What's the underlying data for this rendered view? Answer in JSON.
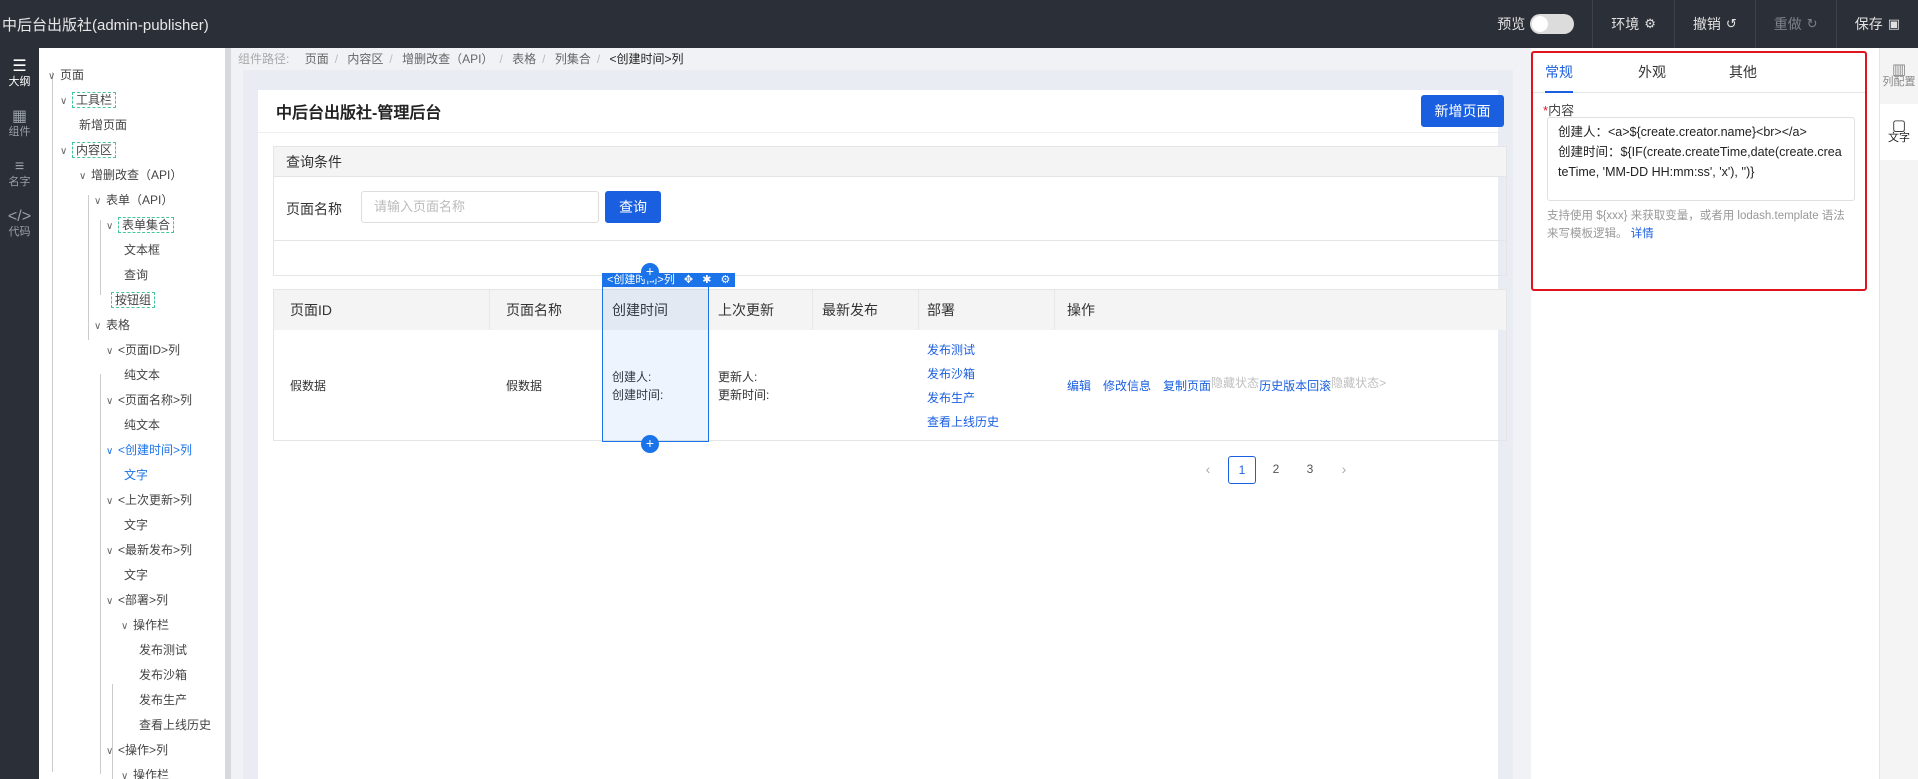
{
  "app": {
    "title": "中后台出版社(admin-publisher)",
    "preview_label": "预览",
    "env_label": "环境",
    "undo_label": "撤销",
    "redo_label": "重做",
    "save_label": "保存"
  },
  "left_rail": [
    {
      "label": "大纲",
      "icon": "outline-icon"
    },
    {
      "label": "组件",
      "icon": "component-icon"
    },
    {
      "label": "名字",
      "icon": "name-list-icon"
    },
    {
      "label": "代码",
      "icon": "code-icon"
    }
  ],
  "outline": {
    "nodes": {
      "n0": "页面",
      "n1": "工具栏",
      "n2": "新增页面",
      "n3": "内容区",
      "n4": "增删改查（API）",
      "n5": "表单（API）",
      "n6": "表单集合",
      "n7": "文本框",
      "n8": "查询",
      "n9": "按钮组",
      "n10": "表格",
      "n11": "<页面ID>列",
      "n12": "纯文本",
      "n13": "<页面名称>列",
      "n14": "纯文本",
      "n15": "<创建时间>列",
      "n16": "文字",
      "n17": "<上次更新>列",
      "n18": "文字",
      "n19": "<最新发布>列",
      "n20": "文字",
      "n21": "<部署>列",
      "n22": "操作栏",
      "n23": "发布测试",
      "n24": "发布沙箱",
      "n25": "发布生产",
      "n26": "查看上线历史",
      "n27": "<操作>列",
      "n28": "操作栏"
    }
  },
  "breadcrumb": {
    "label": "组件路径:",
    "items": [
      "页面",
      "内容区",
      "增删改查（API）",
      "表格",
      "列集合"
    ],
    "current": "<创建时间>列"
  },
  "page": {
    "title": "中后台出版社-管理后台",
    "new_page_button": "新增页面",
    "query": {
      "title": "查询条件",
      "field_label": "页面名称",
      "placeholder": "请输入页面名称",
      "submit": "查询"
    },
    "selection_tag": "<创建时间>列",
    "table": {
      "headers": {
        "id": "页面ID",
        "name": "页面名称",
        "created": "创建时间",
        "updated": "上次更新",
        "published": "最新发布",
        "deploy": "部署",
        "ops": "操作"
      },
      "row": {
        "id": "假数据",
        "name": "假数据",
        "created_by": "创建人:",
        "created_time": "创建时间:",
        "updated_by": "更新人:",
        "updated_time": "更新时间:",
        "deploy_links": [
          "发布测试",
          "发布沙箱",
          "发布生产",
          "查看上线历史"
        ],
        "ops": {
          "edit": "编辑",
          "modify": "修改信息",
          "copy": "复制页面",
          "hidden1": "隐藏状态",
          "history": "历史版本回滚",
          "hidden2": "隐藏状态>"
        }
      }
    },
    "pagination": {
      "pages": [
        "1",
        "2",
        "3"
      ],
      "current": "1"
    }
  },
  "config_panel": {
    "tabs": [
      "常规",
      "外观",
      "其他"
    ],
    "active_tab": "常规",
    "field_label": "内容",
    "content": "创建人：<a>${create.creator.name}<br></a>\n创建时间：${IF(create.createTime,date(create.createTime, 'MM-DD HH:mm:ss', 'x'), '')}",
    "help_text": "支持使用 ${xxx} 来获取变量，或者用 lodash.template 语法来写模板逻辑。",
    "help_link": "详情"
  },
  "right_rail": [
    {
      "label": "列配置",
      "icon": "column-config-icon"
    },
    {
      "label": "文字",
      "icon": "text-icon"
    }
  ]
}
